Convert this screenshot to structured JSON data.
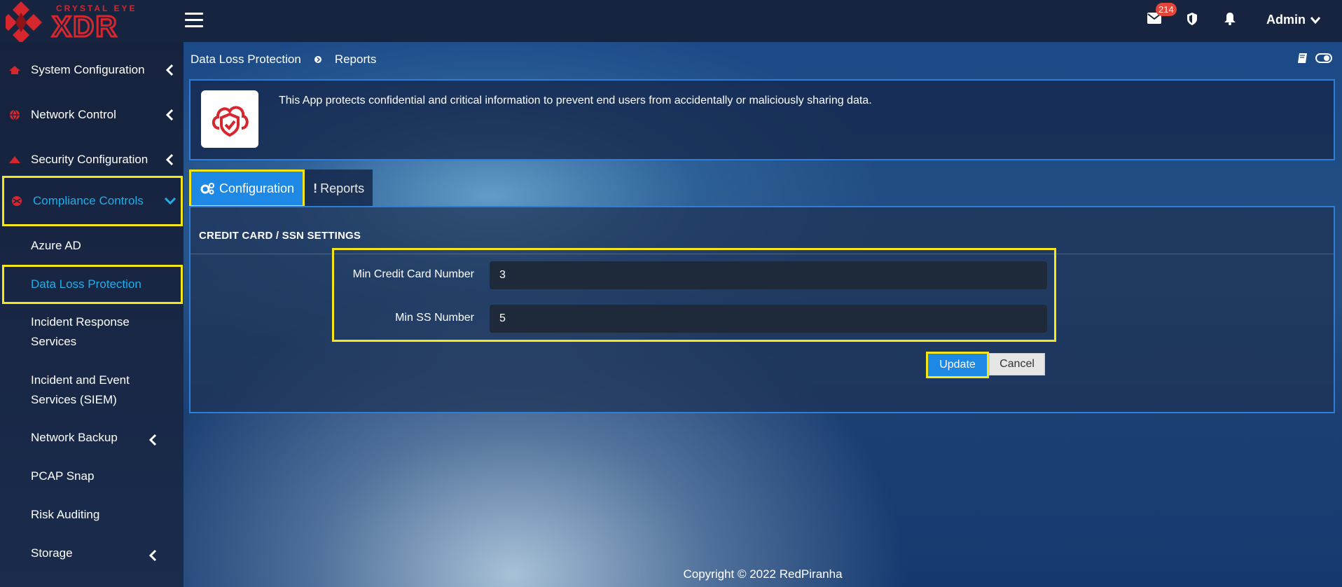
{
  "brand": {
    "top": "CRYSTAL EYE",
    "bottom": "XDR"
  },
  "header": {
    "mail_badge": "214",
    "user_name": "Admin"
  },
  "sidebar": {
    "items": [
      {
        "label": "System Configuration"
      },
      {
        "label": "Network Control"
      },
      {
        "label": "Security Configuration"
      },
      {
        "label": "Compliance Controls"
      }
    ],
    "sub_items": [
      {
        "label": "Azure AD"
      },
      {
        "label": "Data Loss Protection"
      },
      {
        "label": "Incident Response Services"
      },
      {
        "label": "Incident and Event Services (SIEM)"
      },
      {
        "label": "Network Backup"
      },
      {
        "label": "PCAP Snap"
      },
      {
        "label": "Risk Auditing"
      },
      {
        "label": "Storage"
      }
    ]
  },
  "breadcrumb": {
    "parent": "Data Loss Protection",
    "current": "Reports"
  },
  "info": {
    "text": "This App protects confidential and critical information to prevent end users from accidentally or maliciously sharing data."
  },
  "tabs": [
    {
      "label": "Configuration",
      "active": true
    },
    {
      "label": "Reports",
      "active": false
    }
  ],
  "panel": {
    "title": "CREDIT CARD / SSN SETTINGS",
    "fields": [
      {
        "label": "Min Credit Card Number",
        "value": "3"
      },
      {
        "label": "Min SS Number",
        "value": "5"
      }
    ],
    "update_label": "Update",
    "cancel_label": "Cancel"
  },
  "footer": {
    "text": "Copyright © 2022 RedPiranha"
  },
  "colors": {
    "accent": "#1e88e5",
    "highlight": "#f4e51c",
    "active_link": "#1faee8",
    "brand_red": "#d6262e"
  }
}
